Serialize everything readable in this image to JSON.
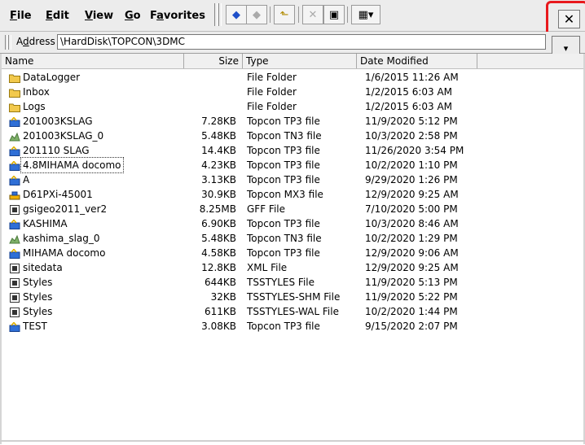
{
  "menu": {
    "items": [
      {
        "label": "File",
        "accel": "F",
        "rest": "ile"
      },
      {
        "label": "Edit",
        "accel": "E",
        "rest": "dit"
      },
      {
        "label": "View",
        "accel": "V",
        "rest": "iew"
      },
      {
        "label": "Go",
        "accel": "G",
        "rest": "o"
      },
      {
        "label": "Favorites",
        "accel": "a",
        "pre": "F",
        "rest": "vorites"
      }
    ]
  },
  "toolbar": {
    "back_icon": "◆",
    "forward_icon": "◆",
    "up_icon": "⬑",
    "delete_icon": "✕",
    "properties_icon": "▣",
    "views_icon": "▦▾",
    "close_icon": "✕"
  },
  "address": {
    "label_accel": "d",
    "label_pre": "A",
    "label_rest": "dress",
    "value": "\\HardDisk\\TOPCON\\3DMC",
    "dropdown_icon": "▾"
  },
  "columns": [
    "Name",
    "Size",
    "Type",
    "Date Modified"
  ],
  "rows": [
    {
      "name": "DataLogger",
      "size": "",
      "type": "File Folder",
      "date": "1/6/2015 11:26 AM",
      "icon": "folder"
    },
    {
      "name": "Inbox",
      "size": "",
      "type": "File Folder",
      "date": "1/2/2015 6:03 AM",
      "icon": "folder"
    },
    {
      "name": "Logs",
      "size": "",
      "type": "File Folder",
      "date": "1/2/2015 6:03 AM",
      "icon": "folder"
    },
    {
      "name": "201003KSLAG",
      "size": "7.28KB",
      "type": "Topcon TP3 file",
      "date": "11/9/2020 5:12 PM",
      "icon": "tp3"
    },
    {
      "name": "201003KSLAG_0",
      "size": "5.48KB",
      "type": "Topcon TN3 file",
      "date": "10/3/2020 2:58 PM",
      "icon": "tn3"
    },
    {
      "name": "201110 SLAG",
      "size": "14.4KB",
      "type": "Topcon TP3 file",
      "date": "11/26/2020 3:54 PM",
      "icon": "tp3"
    },
    {
      "name": "4.8MIHAMA docomo",
      "size": "4.23KB",
      "type": "Topcon TP3 file",
      "date": "10/2/2020 1:10 PM",
      "icon": "tp3",
      "focus": true
    },
    {
      "name": "A",
      "size": "3.13KB",
      "type": "Topcon TP3 file",
      "date": "9/29/2020 1:26 PM",
      "icon": "tp3"
    },
    {
      "name": "D61PXi-45001",
      "size": "30.9KB",
      "type": "Topcon MX3 file",
      "date": "12/9/2020 9:25 AM",
      "icon": "mx3"
    },
    {
      "name": "gsigeo2011_ver2",
      "size": "8.25MB",
      "type": "GFF File",
      "date": "7/10/2020 5:00 PM",
      "icon": "doc"
    },
    {
      "name": "KASHIMA",
      "size": "6.90KB",
      "type": "Topcon TP3 file",
      "date": "10/3/2020 8:46 AM",
      "icon": "tp3"
    },
    {
      "name": "kashima_slag_0",
      "size": "5.48KB",
      "type": "Topcon TN3 file",
      "date": "10/2/2020 1:29 PM",
      "icon": "tn3"
    },
    {
      "name": "MIHAMA docomo",
      "size": "4.58KB",
      "type": "Topcon TP3 file",
      "date": "12/9/2020 9:06 AM",
      "icon": "tp3"
    },
    {
      "name": "sitedata",
      "size": "12.8KB",
      "type": "XML File",
      "date": "12/9/2020 9:25 AM",
      "icon": "doc"
    },
    {
      "name": "Styles",
      "size": "644KB",
      "type": "TSSTYLES File",
      "date": "11/9/2020 5:13 PM",
      "icon": "doc"
    },
    {
      "name": "Styles",
      "size": "32KB",
      "type": "TSSTYLES-SHM File",
      "date": "11/9/2020 5:22 PM",
      "icon": "doc"
    },
    {
      "name": "Styles",
      "size": "611KB",
      "type": "TSSTYLES-WAL File",
      "date": "10/2/2020 1:44 PM",
      "icon": "doc"
    },
    {
      "name": "TEST",
      "size": "3.08KB",
      "type": "Topcon TP3 file",
      "date": "9/15/2020 2:07 PM",
      "icon": "tp3"
    }
  ],
  "colors": {
    "highlight": "#e8191d",
    "folder": "#f2c94c",
    "tp3_blue": "#2f6fd6",
    "tn3_green": "#7fb069"
  }
}
